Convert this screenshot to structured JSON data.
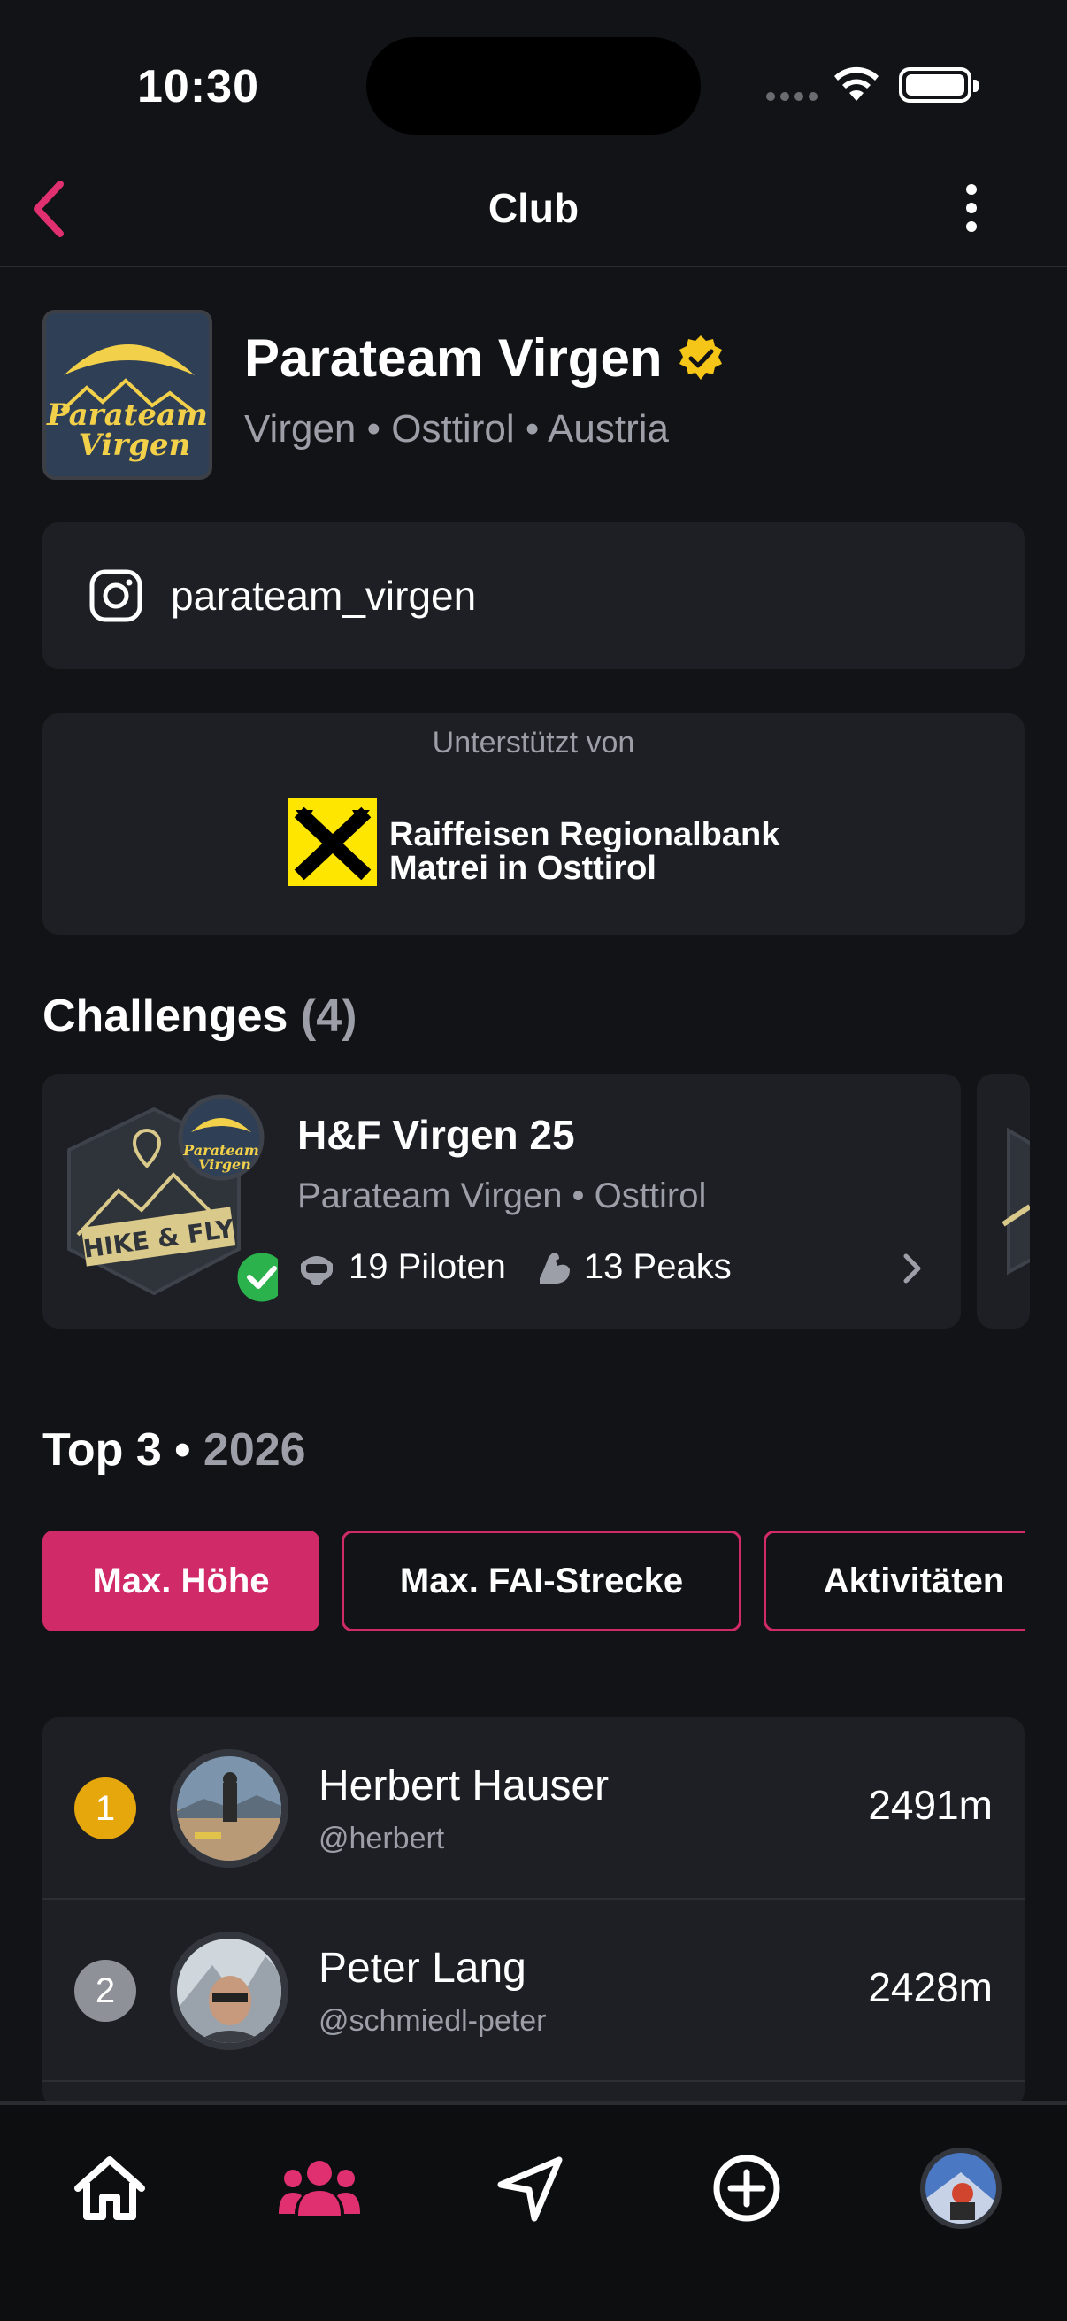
{
  "status_bar": {
    "time": "10:30"
  },
  "nav": {
    "title": "Club"
  },
  "club": {
    "name": "Parateam Virgen",
    "location": "Virgen • Osttirol • Austria",
    "logo_text_line1": "Parateam",
    "logo_text_line2": "Virgen",
    "instagram_handle": "parateam_virgen"
  },
  "sponsor": {
    "label": "Unterstützt von",
    "name_line1": "Raiffeisen Regionalbank",
    "name_line2": "Matrei in Osttirol"
  },
  "challenges": {
    "title": "Challenges",
    "count": "(4)",
    "items": [
      {
        "title": "H&F Virgen 25",
        "subtitle": "Parateam Virgen • Osttirol",
        "pilots": "19 Piloten",
        "peaks": "13 Peaks",
        "badge_text": "HIKE & FLY"
      }
    ]
  },
  "top3": {
    "title": "Top 3 •",
    "year": "2026",
    "tabs": [
      {
        "label": "Max. Höhe",
        "active": true
      },
      {
        "label": "Max. FAI-Strecke",
        "active": false
      },
      {
        "label": "Aktivitäten",
        "active": false
      }
    ],
    "rows": [
      {
        "rank": "1",
        "name": "Herbert Hauser",
        "handle": "@herbert",
        "value": "2491m",
        "rank_color": "#e6a70c"
      },
      {
        "rank": "2",
        "name": "Peter Lang",
        "handle": "@schmiedl-peter",
        "value": "2428m",
        "rank_color": "#8e9198"
      }
    ]
  },
  "tabbar": {
    "items": [
      "home-icon",
      "club-icon",
      "navigate-icon",
      "add-icon",
      "profile-avatar"
    ],
    "active_color": "#e0306f"
  },
  "colors": {
    "accent": "#d12a68",
    "verified": "#f5c518",
    "check": "#2bb24c"
  }
}
